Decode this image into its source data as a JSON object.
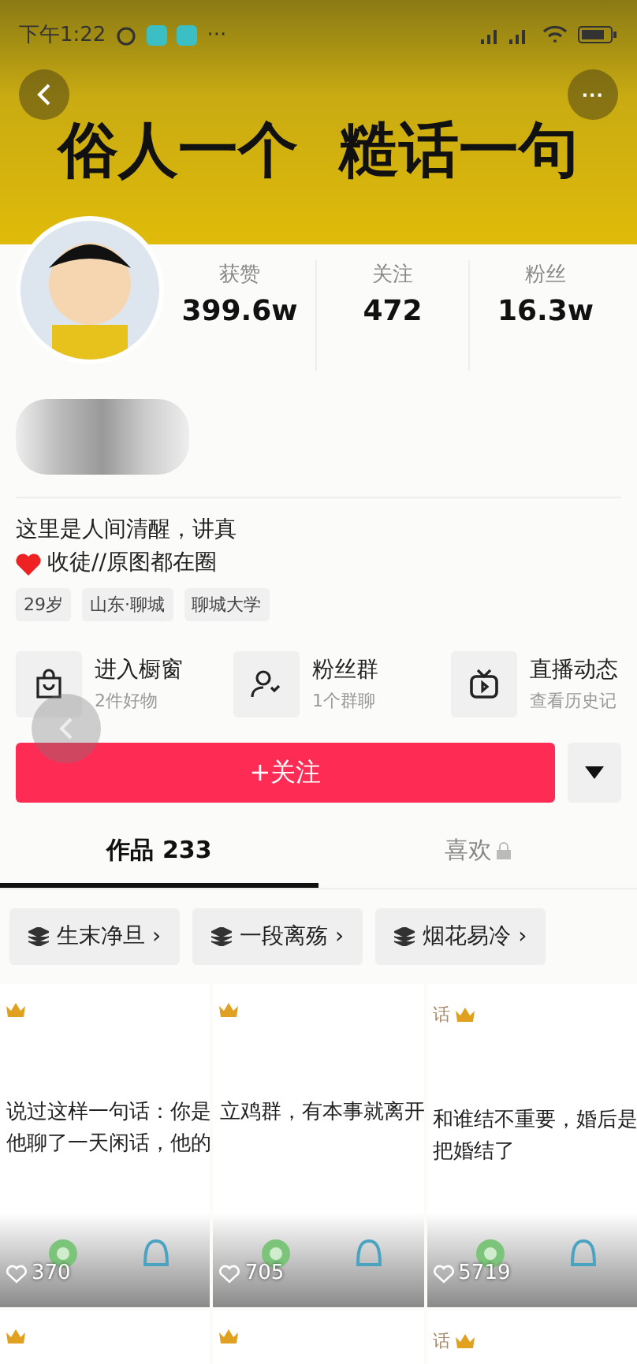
{
  "status_bar": {
    "time": "下午1:22",
    "more": "···"
  },
  "header": {
    "title": "俗人一个  糙话一句",
    "more": "···"
  },
  "stats": [
    {
      "label": "获赞",
      "value": "399.6w"
    },
    {
      "label": "关注",
      "value": "472"
    },
    {
      "label": "粉丝",
      "value": "16.3w"
    }
  ],
  "bio": {
    "line_1": "这里是人间清醒，讲真",
    "line_2": "收徒//原图都在圈"
  },
  "tags": [
    "29岁",
    "山东·聊城",
    "聊城大学"
  ],
  "services": [
    {
      "kind": "bag",
      "title": "进入橱窗",
      "subtitle": "2件好物"
    },
    {
      "kind": "group",
      "title": "粉丝群",
      "subtitle": "1个群聊"
    },
    {
      "kind": "tv",
      "title": "直播动态",
      "subtitle": "查看历史记"
    }
  ],
  "follow_button": "+关注",
  "tabs": [
    {
      "label": "作品 233",
      "selected": true
    },
    {
      "label": "喜欢",
      "selected": false
    }
  ],
  "collections": [
    "生末净旦 ›",
    "一段离殇 ›",
    "烟花易冷 ›"
  ],
  "videos": [
    {
      "lines": [
        "说过这样一句话：你是",
        "他聊了一天闲话，他的"
      ],
      "likes": "370"
    },
    {
      "lines": [
        "立鸡群，有本事就离开"
      ],
      "likes": "705"
    },
    {
      "top": "话",
      "lines": [
        "和谁结不重要，婚后是",
        "把婚结了"
      ],
      "likes": "5719"
    }
  ],
  "videos_row_2": [
    {
      "crown": true
    },
    {
      "crown": true
    },
    {
      "top": "话",
      "crown": true
    }
  ]
}
